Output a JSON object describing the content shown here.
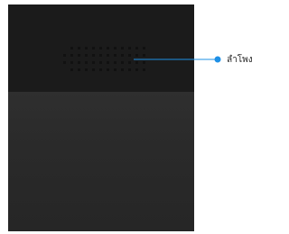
{
  "callout": {
    "label": "ลำโพง",
    "color": "#1e90e6"
  },
  "device": {
    "body_color": "#2b2b2b",
    "top_color": "#1b1b1b",
    "grille_dot_color": "#111111"
  }
}
